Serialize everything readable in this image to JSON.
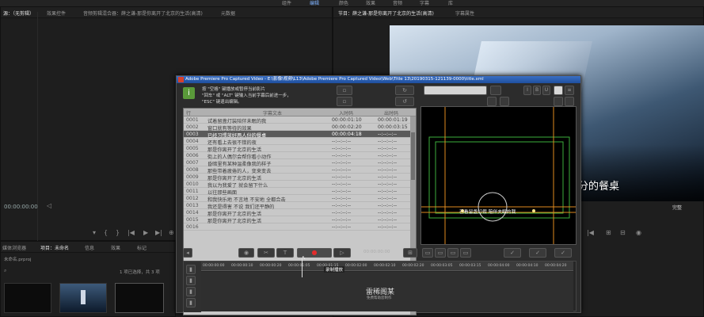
{
  "topbar": {
    "items": [
      "组件",
      "编辑",
      "颜色",
      "效果",
      "音频",
      "字幕",
      "库"
    ],
    "active_index": 1
  },
  "left_panel": {
    "tabs": [
      "源：（无剪辑）",
      "效果控件",
      "音频剪辑混合器：薛之谦-那是你离开了北京的生活(高清)",
      "元数据"
    ],
    "timecode": "00:00:00:00"
  },
  "project_panel": {
    "tabs": [
      "媒体浏览器",
      "项目：未命名",
      "信息",
      "效果",
      "标记"
    ],
    "project_file": "未命名.prproj",
    "selection_info": "1 项已选择，共 3 项"
  },
  "program_panel": {
    "tabs": [
      "节目：薛之谦-那是你离开了北京的生活(高清)",
      "字幕属性"
    ],
    "subtitle_text": "分的餐桌",
    "zoom_label": "完整"
  },
  "dialog": {
    "title": "Adobe Premiere Pro Captured Video - E:\\影像\\视频\\L13\\Adobe Premiere Pro Captured Video\\Web\\Title 13\\20190315-121139-0000\\title.xml",
    "help_lines": [
      "按 \"空格\" 键播放或暂停当前影片",
      "\"回车\" 或 \"ALT\" 键输入当前字幕后前进一步，",
      "\"ESC\" 键退出编辑。"
    ],
    "columns": [
      "行",
      "字幕文本",
      "入时码",
      "出时码"
    ],
    "rows": [
      {
        "idx": "0001",
        "text": "试着留盏灯装陪伴未眠的我",
        "tin": "00:00:01:10",
        "tout": "00:00:01:19"
      },
      {
        "idx": "0002",
        "text": "窗口就有等待的效果",
        "tin": "00:00:02:20",
        "tout": "00:00:03:15"
      },
      {
        "idx": "0003",
        "text": "已经习惯放好两人份的餐桌",
        "tin": "00:00:04:18",
        "tout": "--:--:--:--"
      },
      {
        "idx": "0004",
        "text": "还有看上去很不错的夜",
        "tin": "--:--:--:--",
        "tout": "--:--:--:--"
      },
      {
        "idx": "0005",
        "text": "那是你离开了北京的生活",
        "tin": "--:--:--:--",
        "tout": "--:--:--:--"
      },
      {
        "idx": "0006",
        "text": "街上的人偶尔会帮你看小动作",
        "tin": "--:--:--:--",
        "tout": "--:--:--:--"
      },
      {
        "idx": "0007",
        "text": "昏暗里有某种温柔像我的样子",
        "tin": "--:--:--:--",
        "tout": "--:--:--:--"
      },
      {
        "idx": "0008",
        "text": "那些带着疲倦的人，变来变去",
        "tin": "--:--:--:--",
        "tout": "--:--:--:--"
      },
      {
        "idx": "0009",
        "text": "那是你离开了北京的生活",
        "tin": "--:--:--:--",
        "tout": "--:--:--:--"
      },
      {
        "idx": "0010",
        "text": "我以为我爱了 就会留下什么",
        "tin": "--:--:--:--",
        "tout": "--:--:--:--"
      },
      {
        "idx": "0011",
        "text": "以往那些画面",
        "tin": "--:--:--:--",
        "tout": "--:--:--:--"
      },
      {
        "idx": "0012",
        "text": "和我快乐地 不言地 不安地 全都合击",
        "tin": "--:--:--:--",
        "tout": "--:--:--:--"
      },
      {
        "idx": "0013",
        "text": "我还是得害 不说 我们还平静的",
        "tin": "--:--:--:--",
        "tout": "--:--:--:--"
      },
      {
        "idx": "0014",
        "text": "那是你离开了北京的生活",
        "tin": "--:--:--:--",
        "tout": "--:--:--:--"
      },
      {
        "idx": "0015",
        "text": "那是你离开了北京的生活",
        "tin": "--:--:--:--",
        "tout": "--:--:--:--"
      },
      {
        "idx": "0016",
        "text": "",
        "tin": "--:--:--:--",
        "tout": "--:--:--:--"
      }
    ],
    "selected_row": 2,
    "preview_caption": "已看留盏灯假 陪伴夫眠的我",
    "toolbar_time": "00:00:00:00",
    "record_tooltip": "录制播放",
    "ruler_ticks": [
      "00:00:00:00",
      "00:00:00:10",
      "00:00:00:20",
      "00:00:01:05",
      "00:00:01:15",
      "00:00:02:00",
      "00:00:02:10",
      "00:00:02:20",
      "00:00:03:05",
      "00:00:03:15",
      "00:00:04:00",
      "00:00:04:10",
      "00:00:04:20"
    ],
    "clip_logo_top": "雷稀阁某",
    "clip_logo_bottom": "免费帮助您制作"
  }
}
